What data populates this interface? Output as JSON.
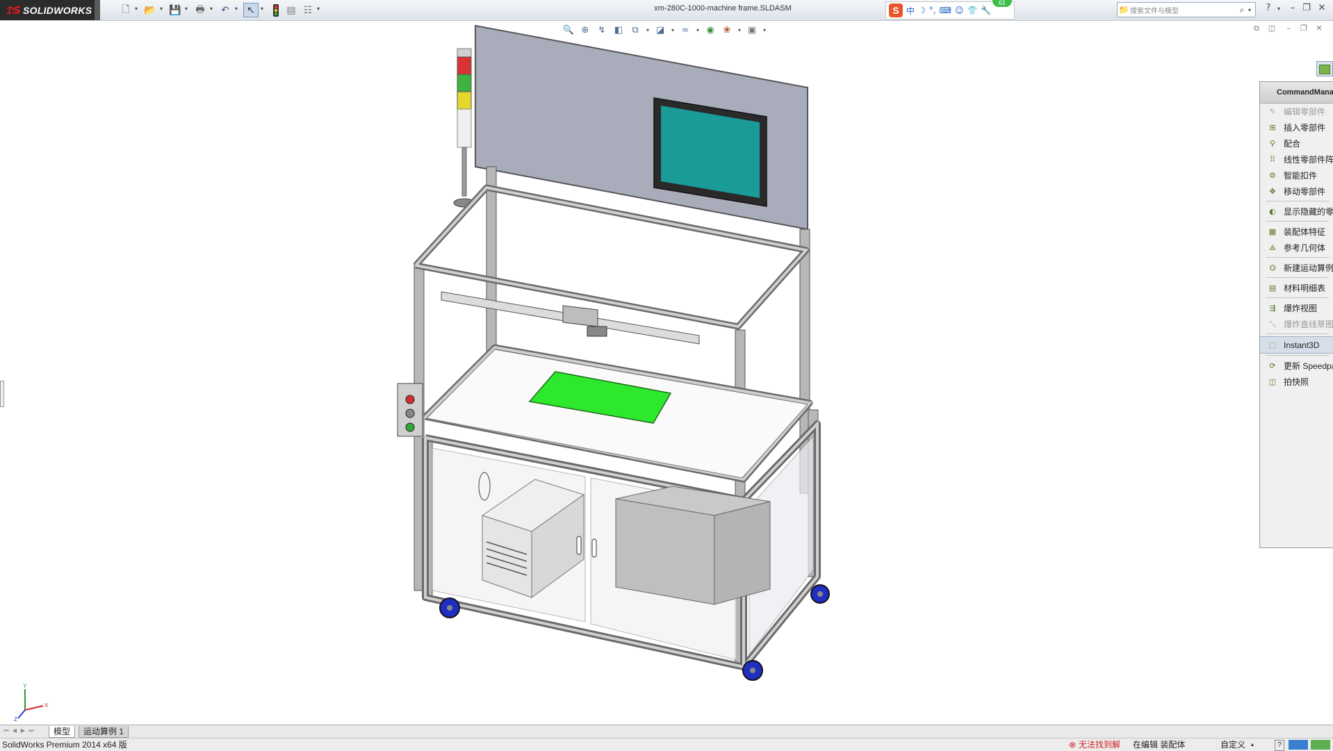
{
  "app": {
    "brand": "SOLIDWORKS",
    "document_title": "xm-280C-1000-machine frame.SLDASM"
  },
  "toolbar": {
    "icons": [
      "new-document-icon",
      "open-folder-icon",
      "save-icon",
      "print-icon",
      "undo-icon",
      "select-pointer-icon",
      "rebuild-traffic-light-icon",
      "file-properties-icon",
      "options-icon"
    ]
  },
  "ime": {
    "logo": "S",
    "items": [
      "中",
      "☽",
      "°,",
      "⌨",
      "☺",
      "👕",
      "🔧"
    ],
    "badge": "61"
  },
  "search": {
    "placeholder": "搜索文件与模型"
  },
  "window_controls": [
    "?",
    "–",
    "❐",
    "✕"
  ],
  "heads_up_icons": [
    "zoom-to-fit-icon",
    "zoom-to-area-icon",
    "previous-view-icon",
    "section-view-icon",
    "view-orientation-icon",
    "display-style-icon",
    "hide-show-items-icon",
    "edit-appearance-icon",
    "apply-scene-icon",
    "view-settings-icon"
  ],
  "command_manager": {
    "title": "CommandManager",
    "items": [
      {
        "label": "编辑零部件",
        "icon": "edit-component-icon",
        "disabled": true
      },
      {
        "label": "插入零部件",
        "icon": "insert-component-icon"
      },
      {
        "label": "配合",
        "icon": "mate-icon"
      },
      {
        "label": "线性零部件阵列",
        "icon": "linear-pattern-icon"
      },
      {
        "label": "智能扣件",
        "icon": "smart-fasteners-icon"
      },
      {
        "label": "移动零部件",
        "icon": "move-component-icon"
      },
      {
        "label": "显示隐藏的零部件",
        "icon": "show-hidden-components-icon",
        "sep_before": true
      },
      {
        "label": "装配体特征",
        "icon": "assembly-features-icon",
        "sep_before": true
      },
      {
        "label": "参考几何体",
        "icon": "reference-geometry-icon"
      },
      {
        "label": "新建运动算例",
        "icon": "new-motion-study-icon",
        "sep_before": true
      },
      {
        "label": "材料明细表",
        "icon": "bill-of-materials-icon",
        "sep_before": true
      },
      {
        "label": "爆炸视图",
        "icon": "exploded-view-icon",
        "sep_before": true
      },
      {
        "label": "爆炸直线草图",
        "icon": "explode-line-sketch-icon",
        "disabled": true
      },
      {
        "label": "Instant3D",
        "icon": "instant3d-icon",
        "active": true,
        "sep_before": true
      },
      {
        "label": "更新 Speedpak",
        "icon": "update-speedpak-icon",
        "sep_before": true
      },
      {
        "label": "拍快照",
        "icon": "take-snapshot-icon"
      }
    ]
  },
  "tabs": [
    {
      "label": "模型",
      "selected": true
    },
    {
      "label": "运动算例 1",
      "selected": false
    }
  ],
  "status": {
    "product": "SolidWorks Premium 2014 x64 版",
    "error": "无法找到解",
    "mode": "在编辑 装配体",
    "custom": "自定义",
    "help": "?"
  },
  "colors": {
    "error": "#d12020",
    "monitor_screen": "#1a9b98",
    "pcb_board": "#2ee82e",
    "wheel": "#1f2fbf",
    "backboard": "#a9adbb"
  }
}
